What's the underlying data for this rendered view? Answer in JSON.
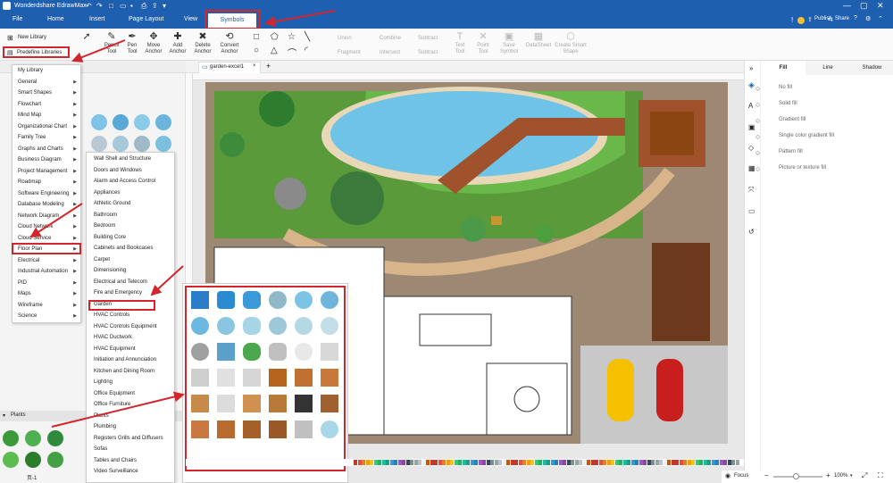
{
  "app": {
    "title": "Wonderdshare EdrawMax",
    "publish": "Publish",
    "share": "Share"
  },
  "menu": {
    "file": "File",
    "home": "Home",
    "insert": "Insert",
    "page_layout": "Page Layout",
    "view": "View",
    "symbols": "Symbols"
  },
  "ribbon": {
    "new_library": "New Library",
    "predefine_libraries": "Predefine Libraries",
    "pencil": "Pencil Tool",
    "pen": "Pen Tool",
    "move_anchor": "Move Anchor",
    "add_anchor": "Add Anchor",
    "delete_anchor": "Delete Anchor",
    "convert_anchor": "Convert Anchor",
    "union": "Union",
    "combine": "Combine",
    "subtract": "Subtract",
    "fragment": "Fragment",
    "intersect": "Intersect",
    "subtract2": "Subtract",
    "text_tool": "Text Tool",
    "point_tool": "Point Tool",
    "save_symbol": "Save Symbol",
    "datasheet": "DataSheet",
    "create_smart_shape": "Create Smart Shape"
  },
  "doc_tab": {
    "label": "garden-excel1"
  },
  "predefine_menu": [
    "My Library",
    "General",
    "Smart Shapes",
    "Flowchart",
    "Mind Map",
    "Organizational Chart",
    "Family Tree",
    "Graphs and Charts",
    "Business Diagram",
    "Project Management",
    "Roadmap",
    "Software Engineering",
    "Database Modeling",
    "Network Diagram",
    "Cloud Network",
    "Cloud Service",
    "Floor Plan",
    "Electrical",
    "Industrial Automation",
    "PID",
    "Maps",
    "Wireframe",
    "Science"
  ],
  "floorplan_menu": [
    "Wall Shell and Structure",
    "Doors and Windows",
    "Alarm and Access Control",
    "Appliances",
    "Athletic Ground",
    "Bathroom",
    "Bedroom",
    "Building Core",
    "Cabinets and Bookcases",
    "Carpet",
    "Dimensioning",
    "Electrical and Telecom",
    "Fire and Emergency",
    "Garden",
    "HVAC Controls",
    "HVAC Controls Equipment",
    "HVAC Ductwork",
    "HVAC Equipment",
    "Initiation and Annunciation",
    "Kitchen and Dining Room",
    "Lighting",
    "Office Equipment",
    "Office Furniture",
    "Plants",
    "Plumbing",
    "Registers Grills and Diffusers",
    "Sofas",
    "Tables and Chairs",
    "Video Surveillance"
  ],
  "left_panel": {
    "plants_header": "Plants",
    "page_label": "页-1"
  },
  "right_panel": {
    "tabs": [
      "Fill",
      "Line",
      "Shadow"
    ],
    "fill_options": [
      "No fill",
      "Solid fill",
      "Gradient fill",
      "Single color gradient fill",
      "Pattern fill",
      "Picture or texture fill"
    ]
  },
  "status": {
    "focus": "Focus",
    "zoom": "100%"
  },
  "colors": {
    "titlebar": "#1f5fb0",
    "highlight": "#d3262c",
    "active_tab_bg": "#ffffff"
  }
}
